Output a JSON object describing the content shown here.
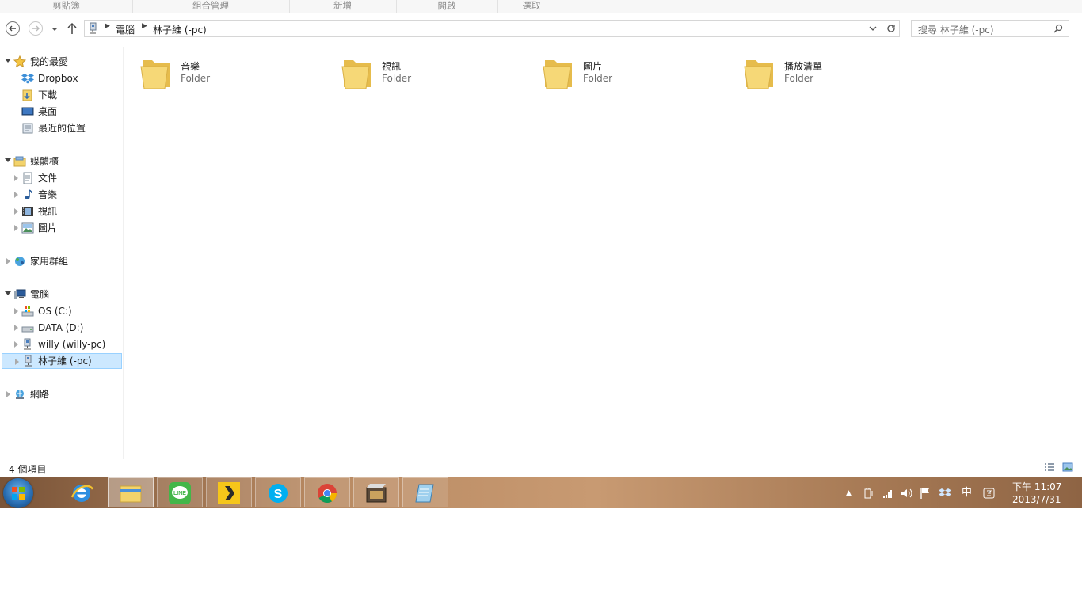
{
  "ribbon": {
    "groups": [
      "剪貼簿",
      "組合管理",
      "新增",
      "開啟",
      "選取"
    ]
  },
  "address_bar": {
    "segments": [
      "電腦",
      "林子維 (-pc)"
    ]
  },
  "search": {
    "placeholder": "搜尋 林子維 (-pc)"
  },
  "nav_pane": {
    "favorites": {
      "label": "我的最愛",
      "items": [
        "Dropbox",
        "下載",
        "桌面",
        "最近的位置"
      ]
    },
    "libraries": {
      "label": "媒體櫃",
      "items": [
        "文件",
        "音樂",
        "視訊",
        "圖片"
      ]
    },
    "homegroup": {
      "label": "家用群組"
    },
    "computer": {
      "label": "電腦",
      "items": [
        "OS (C:)",
        "DATA (D:)",
        "willy (willy-pc)",
        "林子維 (-pc)"
      ]
    },
    "network": {
      "label": "網路"
    }
  },
  "folders": [
    {
      "name": "音樂",
      "type": "Folder"
    },
    {
      "name": "視訊",
      "type": "Folder"
    },
    {
      "name": "圖片",
      "type": "Folder"
    },
    {
      "name": "播放清單",
      "type": "Folder"
    }
  ],
  "status": {
    "count": "4 個項目"
  },
  "taskbar": {
    "apps": [
      "internet-explorer-icon",
      "file-explorer-icon",
      "line-icon",
      "plex-icon",
      "skype-icon",
      "chrome-icon",
      "media-app-icon",
      "notes-app-icon"
    ],
    "tray": {
      "ime": "中"
    },
    "clock": {
      "time": "下午 11:07",
      "date": "2013/7/31"
    }
  },
  "colors": {
    "selection": "#cce8ff",
    "selection_border": "#99d1ff",
    "folder": "#f3d36b",
    "taskbar": "#b98a62"
  }
}
